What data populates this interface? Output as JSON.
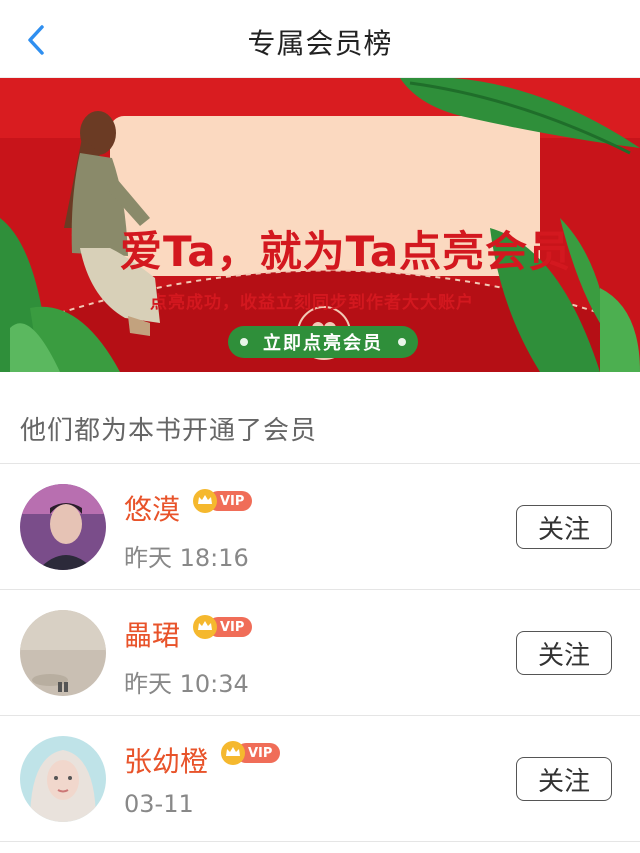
{
  "navbar": {
    "back_icon": "chevron-left-icon",
    "title": "专属会员榜",
    "accent_color": "#2f8ff0"
  },
  "banner": {
    "title": "爱Ta，就为Ta点亮会员",
    "subtitle": "点亮成功，收益立刻同步到作者大大账户",
    "cta_label": "立即点亮会员",
    "colors": {
      "background": "#c8141a",
      "card": "#fbd9c0",
      "cta": "#2f8f3a",
      "text": "#d3181f"
    }
  },
  "section": {
    "title": "他们都为本书开通了会员"
  },
  "members": [
    {
      "name": "悠漠",
      "badge": "VIP",
      "time": "昨天 18:16",
      "follow_label": "关注",
      "avatar": "avatar-portrait-man"
    },
    {
      "name": "畾珺",
      "badge": "VIP",
      "time": "昨天 10:34",
      "follow_label": "关注",
      "avatar": "avatar-beach-sand"
    },
    {
      "name": "张幼橙",
      "badge": "VIP",
      "time": "03-11",
      "follow_label": "关注",
      "avatar": "avatar-illustrated-girl"
    }
  ],
  "colors": {
    "name": "#e8532a",
    "vip_badge": "#f06d58",
    "crown": "#f5b82e"
  }
}
